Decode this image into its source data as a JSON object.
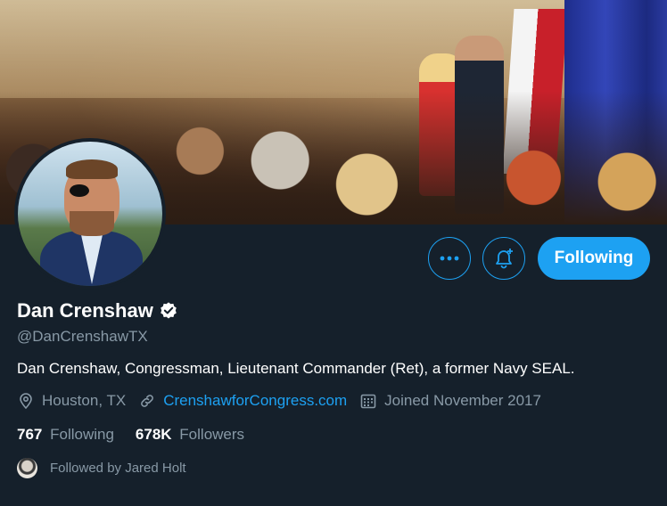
{
  "profile": {
    "name": "Dan Crenshaw",
    "handle": "@DanCrenshawTX",
    "bio": "Dan Crenshaw, Congressman, Lieutenant Commander (Ret), a former Navy SEAL.",
    "location": "Houston, TX",
    "website": "CrenshawforCongress.com",
    "joined": "Joined November 2017"
  },
  "actions": {
    "following_label": "Following"
  },
  "stats": {
    "following_count": "767",
    "following_label": "Following",
    "followers_count": "678K",
    "followers_label": "Followers"
  },
  "followed_by": "Followed by Jared Holt",
  "colors": {
    "background": "#15202b",
    "accent": "#1da1f2",
    "secondary_text": "#8899a6"
  },
  "icons": [
    "more-icon",
    "notification-bell-plus-icon",
    "verified-badge-icon",
    "location-icon",
    "link-icon",
    "calendar-icon"
  ]
}
